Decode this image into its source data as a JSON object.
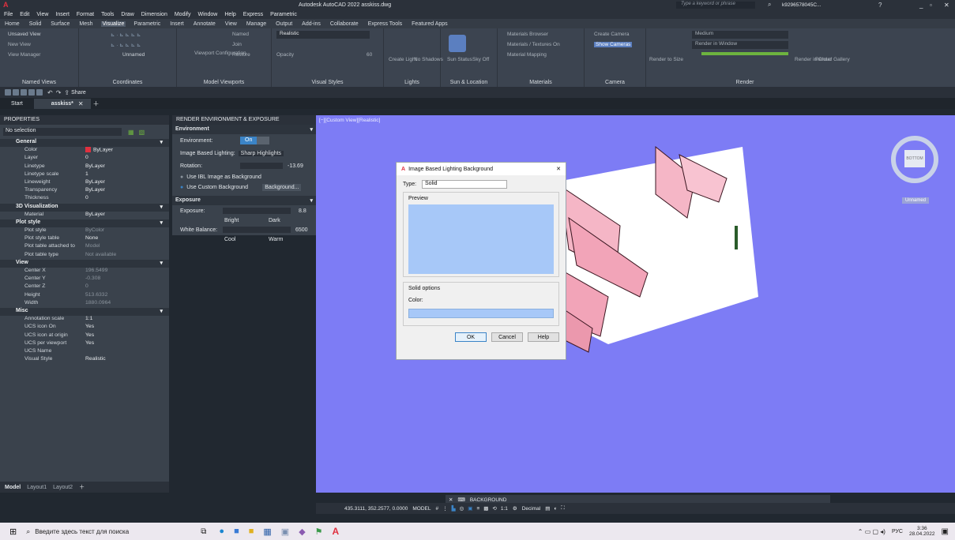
{
  "app": {
    "title": "Autodesk AutoCAD 2022  asskiss.dwg",
    "search_placeholder": "Type a keyword or phrase",
    "user": "k9296578045C...",
    "logo": "A"
  },
  "menu": [
    "File",
    "Edit",
    "View",
    "Insert",
    "Format",
    "Tools",
    "Draw",
    "Dimension",
    "Modify",
    "Window",
    "Help",
    "Express",
    "Parametric"
  ],
  "ribbon_tabs": [
    "Home",
    "Solid",
    "Surface",
    "Mesh",
    "Visualize",
    "Parametric",
    "Insert",
    "Annotate",
    "View",
    "Manage",
    "Output",
    "Add-ins",
    "Collaborate",
    "Express Tools",
    "Featured Apps"
  ],
  "ribbon": {
    "named_views": {
      "label": "Named Views",
      "items": [
        "Unsaved View",
        "New View",
        "View Manager"
      ]
    },
    "coordinates": {
      "label": "Coordinates",
      "unnamed": "Unnamed"
    },
    "model_viewports": {
      "label": "Model Viewports",
      "items": [
        "Viewport Configuration",
        "Named",
        "Join",
        "Restore"
      ]
    },
    "visual_styles": {
      "label": "Visual Styles",
      "style": "Realistic",
      "opacity": "Opacity",
      "opacity_val": "60"
    },
    "lights": {
      "label": "Lights",
      "items": [
        "Create Light",
        "No Shadows"
      ]
    },
    "sun": {
      "label": "Sun & Location",
      "items": [
        "Sun Status",
        "Sky Off"
      ]
    },
    "materials": {
      "label": "Materials",
      "items": [
        "Materials Browser",
        "Materials / Textures On",
        "Material Mapping"
      ]
    },
    "camera": {
      "label": "Camera",
      "items": [
        "Create Camera",
        "Show Cameras"
      ]
    },
    "render": {
      "label": "Render",
      "items": [
        "Render to Size",
        "Medium",
        "Render in Window",
        "Render in Cloud",
        "Render Gallery"
      ]
    }
  },
  "qat": {
    "share": "Share"
  },
  "doc_tabs": [
    "Start",
    "asskiss*"
  ],
  "properties": {
    "title": "PROPERTIES",
    "selection": "No selection",
    "sections": [
      {
        "name": "General",
        "rows": [
          [
            "Color",
            "ByLayer"
          ],
          [
            "Layer",
            "0"
          ],
          [
            "Linetype",
            "ByLayer"
          ],
          [
            "Linetype scale",
            "1"
          ],
          [
            "Lineweight",
            "ByLayer"
          ],
          [
            "Transparency",
            "ByLayer"
          ],
          [
            "Thickness",
            "0"
          ]
        ]
      },
      {
        "name": "3D Visualization",
        "rows": [
          [
            "Material",
            "ByLayer"
          ]
        ]
      },
      {
        "name": "Plot style",
        "rows": [
          [
            "Plot style",
            "ByColor"
          ],
          [
            "Plot style table",
            "None"
          ],
          [
            "Plot table attached to",
            "Model"
          ],
          [
            "Plot table type",
            "Not available"
          ]
        ]
      },
      {
        "name": "View",
        "rows": [
          [
            "Center X",
            "196.5499"
          ],
          [
            "Center Y",
            "-0.308"
          ],
          [
            "Center Z",
            "0"
          ],
          [
            "Height",
            "513.6332"
          ],
          [
            "Width",
            "1880.0964"
          ]
        ]
      },
      {
        "name": "Misc",
        "rows": [
          [
            "Annotation scale",
            "1:1"
          ],
          [
            "UCS icon On",
            "Yes"
          ],
          [
            "UCS icon at origin",
            "Yes"
          ],
          [
            "UCS per viewport",
            "Yes"
          ],
          [
            "UCS Name",
            ""
          ],
          [
            "Visual Style",
            "Realistic"
          ]
        ]
      }
    ],
    "color_swatch": "#e0303f"
  },
  "render_env": {
    "title": "RENDER ENVIRONMENT & EXPOSURE",
    "environment": "Environment",
    "env_label": "Environment:",
    "env_value": "On",
    "ibl_label": "Image Based Lighting:",
    "ibl_value": "Sharp Highlights",
    "rotation_label": "Rotation:",
    "rotation_value": "-13.69",
    "opt1": "Use IBL Image as Background",
    "opt2": "Use Custom Background",
    "bg_button": "Background...",
    "exposure": "Exposure",
    "exposure_label": "Exposure:",
    "exposure_value": "8.8",
    "bright": "Bright",
    "dark": "Dark",
    "wb_label": "White Balance:",
    "wb_value": "6500",
    "cool": "Cool",
    "warm": "Warm"
  },
  "viewport": {
    "label": "[−][Custom View][Realistic]",
    "unnamed": "Unnamed",
    "cube": "BOTTOM",
    "bg": "#7d7cf5"
  },
  "dialog": {
    "title": "Image Based Lighting Background",
    "type_label": "Type:",
    "type_value": "Solid",
    "preview": "Preview",
    "solid_options": "Solid options",
    "color_label": "Color:",
    "ok": "OK",
    "cancel": "Cancel",
    "help": "Help",
    "preview_color": "#a7c8f8"
  },
  "layout_tabs": [
    "Model",
    "Layout1",
    "Layout2"
  ],
  "command": "BACKGROUND",
  "status": {
    "coords": "435.3111, 352.2577, 0.0000",
    "model": "MODEL",
    "scale": "1:1",
    "units": "Decimal"
  },
  "taskbar": {
    "search": "Введите здесь текст для поиска",
    "lang": "РУС",
    "time": "3:36",
    "date": "28.04.2022"
  }
}
